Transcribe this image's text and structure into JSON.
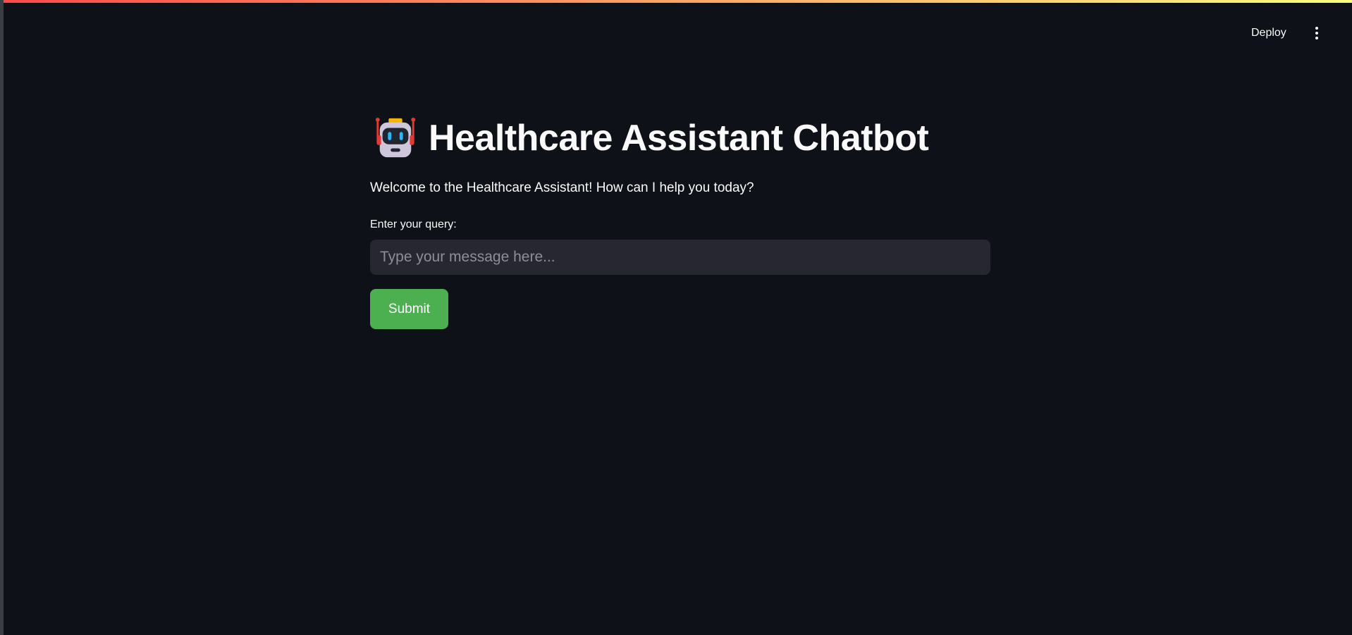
{
  "header": {
    "deploy_label": "Deploy",
    "menu_icon": "vertical-ellipsis-icon"
  },
  "main": {
    "title_icon": "robot-icon",
    "title": "Healthcare Assistant Chatbot",
    "welcome": "Welcome to the Healthcare Assistant! How can I help you today?",
    "query_label": "Enter your query:",
    "query_value": "",
    "query_placeholder": "Type your message here...",
    "submit_label": "Submit"
  },
  "colors": {
    "background": "#0e1117",
    "input_background": "#262730",
    "submit_button": "#4caf50",
    "text": "#fafafa",
    "accent_gradient_start": "#ff4b4b",
    "accent_gradient_end": "#fffd80"
  }
}
